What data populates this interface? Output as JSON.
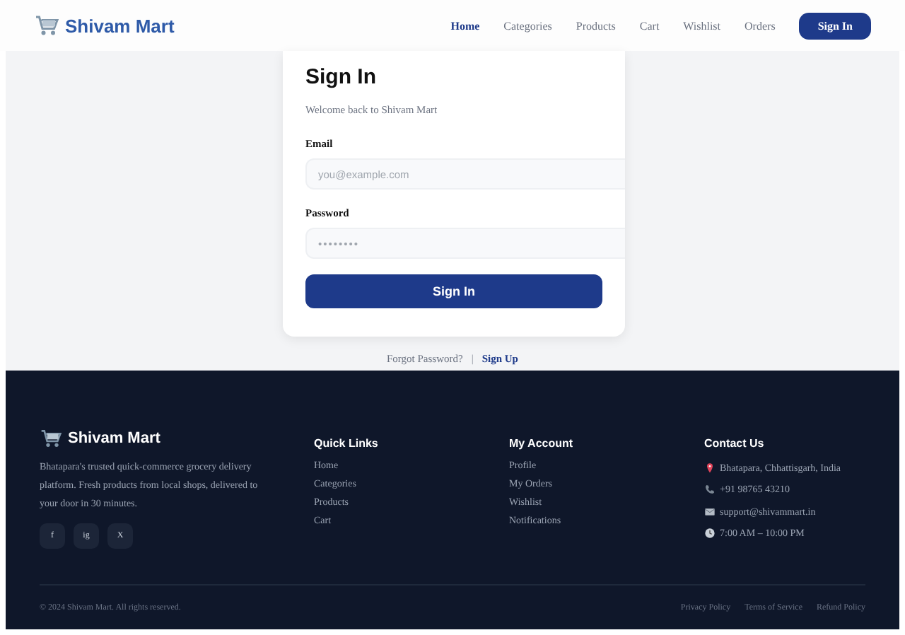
{
  "header": {
    "brand": "Shivam Mart",
    "nav": [
      {
        "label": "Home",
        "selected": true
      },
      {
        "label": "Categories",
        "selected": false
      },
      {
        "label": "Products",
        "selected": false
      },
      {
        "label": "Cart",
        "selected": false
      },
      {
        "label": "Wishlist",
        "selected": false
      },
      {
        "label": "Orders",
        "selected": false
      }
    ],
    "action": "Sign In"
  },
  "signin": {
    "title": "Sign In",
    "subtitle": "Welcome back to Shivam Mart",
    "fields": [
      {
        "label": "Email",
        "placeholder": "you@example.com",
        "kind": "email"
      },
      {
        "label": "Password",
        "placeholder": "••••••••",
        "kind": "password"
      }
    ],
    "submit": "Sign In",
    "forgot": "Forgot Password?",
    "separator": "|",
    "signup": "Sign Up"
  },
  "footer": {
    "brand": "Shivam Mart",
    "about": "Bhatapara's trusted quick-commerce grocery delivery platform. Fresh products from local shops, delivered to your door in 30 minutes.",
    "social": [
      "f",
      "ig",
      "X"
    ],
    "columns": [
      {
        "title": "Quick Links",
        "links": [
          "Home",
          "Categories",
          "Products",
          "Cart"
        ]
      },
      {
        "title": "My Account",
        "links": [
          "Profile",
          "My Orders",
          "Wishlist",
          "Notifications"
        ]
      }
    ],
    "contact": {
      "title": "Contact Us",
      "items": [
        {
          "kind": "location",
          "text": "Bhatapara, Chhattisgarh, India"
        },
        {
          "kind": "phone",
          "text": "+91 98765 43210"
        },
        {
          "kind": "email",
          "text": "support@shivammart.in"
        },
        {
          "kind": "hours",
          "text": "7:00 AM – 10:00 PM"
        }
      ]
    },
    "copyright": "© 2024 Shivam Mart. All rights reserved.",
    "legal": [
      "Privacy Policy",
      "Terms of Service",
      "Refund Policy"
    ]
  }
}
